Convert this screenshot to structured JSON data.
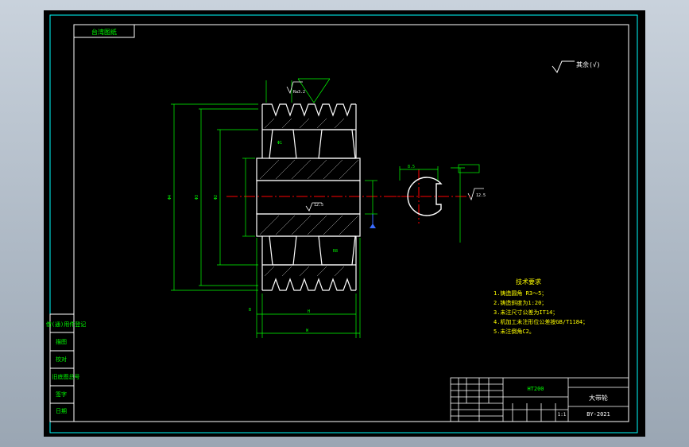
{
  "drawing": {
    "title_corner_label": "台湾图纸",
    "surface_finish_note": "其余(√)",
    "surface_finish_value": "12.5",
    "part_name": "大带轮",
    "drawing_number": "BY-2021",
    "material": "HT200",
    "scale": "1:1",
    "notes_title": "技术要求",
    "notes": [
      "1.铸造圆角 R3～5；",
      "2.铸造斜度为1:20；",
      "3.未注尺寸公差为IT14；",
      "4.机加工未注形位公差按GB/T1184；",
      "5.未注倒角C2。"
    ],
    "left_strip_labels": [
      "借(通)用件登记",
      "旧底图总号",
      "底图总号",
      "签字",
      "日期"
    ],
    "left_strip_sublabels": [
      "描图",
      "校对"
    ],
    "keyway_dim": "8.5",
    "dim_a": "Ra3.2",
    "dim_b": "12.5"
  },
  "colors": {
    "line_white": "#ffffff",
    "line_green": "#00ff00",
    "line_cyan": "#00ffff",
    "line_red": "#ff0000",
    "line_yellow": "#ffff00",
    "line_blue": "#3a6bff"
  }
}
